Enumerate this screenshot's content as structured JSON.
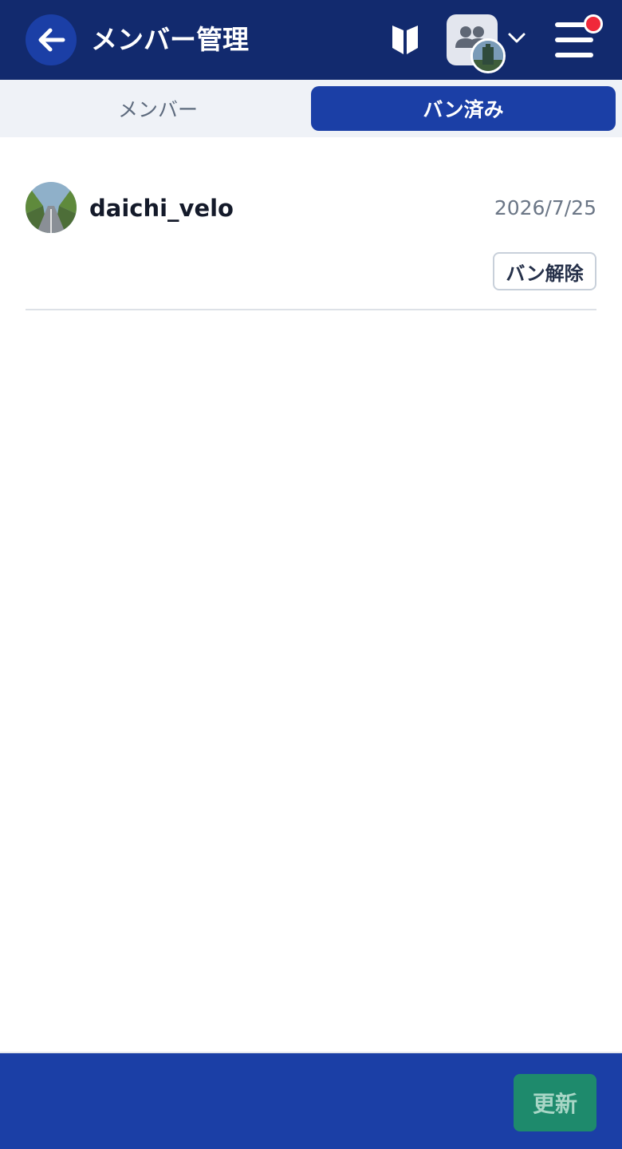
{
  "header": {
    "title": "メンバー管理",
    "back_icon": "arrow-left-icon",
    "beginner_icon": "beginner-mark-icon",
    "group_icon": "people-icon",
    "dropdown_icon": "chevron-down-icon",
    "menu_icon": "hamburger-menu-icon",
    "has_notification": true
  },
  "tabs": [
    {
      "label": "メンバー",
      "active": false
    },
    {
      "label": "バン済み",
      "active": true
    }
  ],
  "banned_list": [
    {
      "username": "daichi_velo",
      "date": "2026/7/25",
      "action_label": "バン解除"
    }
  ],
  "footer": {
    "refresh_label": "更新"
  },
  "colors": {
    "header_bg": "#122a6e",
    "accent": "#1b3fa6",
    "refresh_green": "#1e8a6c",
    "notification_red": "#f0293a"
  }
}
